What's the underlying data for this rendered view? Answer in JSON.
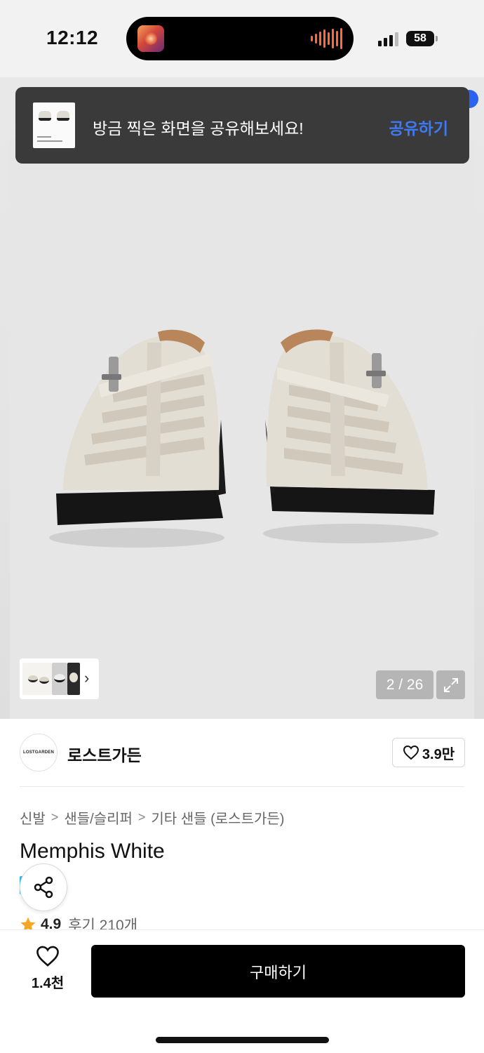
{
  "status_bar": {
    "time": "12:12",
    "battery": "58",
    "island_icon": "now-playing-album-art",
    "signal_icon": "cellular-signal-icon"
  },
  "toast": {
    "message": "방금 찍은 화면을 공유해보세요!",
    "action_label": "공유하기",
    "action_color": "#3d79f5"
  },
  "gallery": {
    "counter": "2 / 26",
    "expand_icon": "expand-icon",
    "next_icon": "chevron-right-icon"
  },
  "brand": {
    "logo_text": "LOSTGARDEN",
    "name": "로스트가든",
    "likes": "3.9만"
  },
  "breadcrumb": {
    "items": [
      "신발",
      "샌들/슬리퍼",
      "기타 샌들 (로스트가든)"
    ]
  },
  "product": {
    "title": "Memphis White",
    "rating": "4.9",
    "reviews": "후기 210개"
  },
  "bottom_bar": {
    "wish_count": "1.4천",
    "buy_label": "구매하기"
  },
  "colors": {
    "accent_blue": "#2b63f0",
    "star": "#f5a623",
    "buy_button": "#000000"
  }
}
